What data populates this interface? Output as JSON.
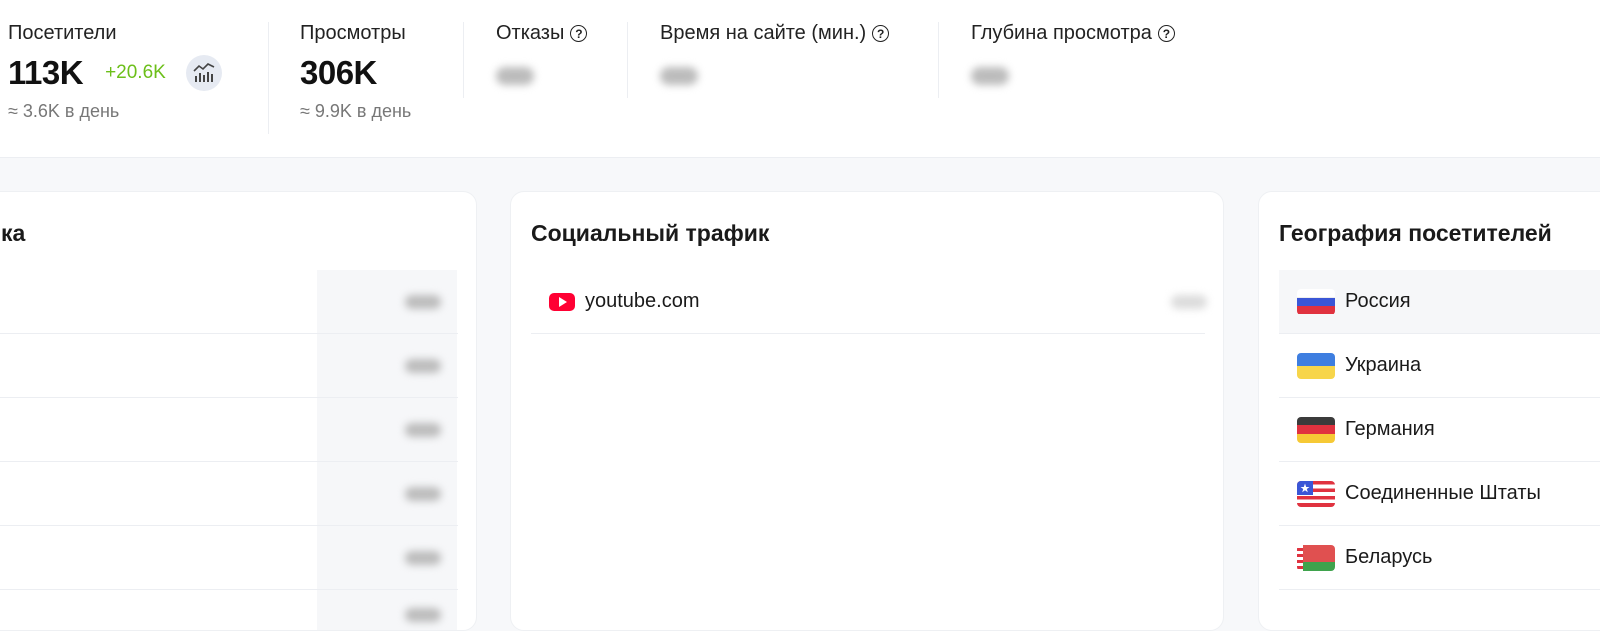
{
  "stats": {
    "visitors": {
      "label": "Посетители",
      "value": "113K",
      "delta": "+20.6K",
      "per_day": "≈ 3.6K в день"
    },
    "views": {
      "label": "Просмотры",
      "value": "306K",
      "per_day": "≈ 9.9K в день"
    },
    "bounces": {
      "label": "Отказы"
    },
    "time_on_site": {
      "label": "Время на сайте (мин.)"
    },
    "depth": {
      "label": "Глубина просмотра"
    }
  },
  "left_card": {
    "title_fragment": "ка"
  },
  "social": {
    "title": "Социальный трафик",
    "items": [
      {
        "name": "youtube.com",
        "icon": "youtube-icon"
      }
    ]
  },
  "geo": {
    "title": "География посетителей",
    "countries": [
      {
        "name": "Россия",
        "flag": "russia-flag-icon"
      },
      {
        "name": "Украина",
        "flag": "ukraine-flag-icon"
      },
      {
        "name": "Германия",
        "flag": "germany-flag-icon"
      },
      {
        "name": "Соединенные Штаты",
        "flag": "usa-flag-icon"
      },
      {
        "name": "Беларусь",
        "flag": "belarus-flag-icon"
      }
    ]
  },
  "colors": {
    "delta_green": "#6cbf1a",
    "youtube_red": "#ff0033",
    "background": "#f7f8fa"
  }
}
